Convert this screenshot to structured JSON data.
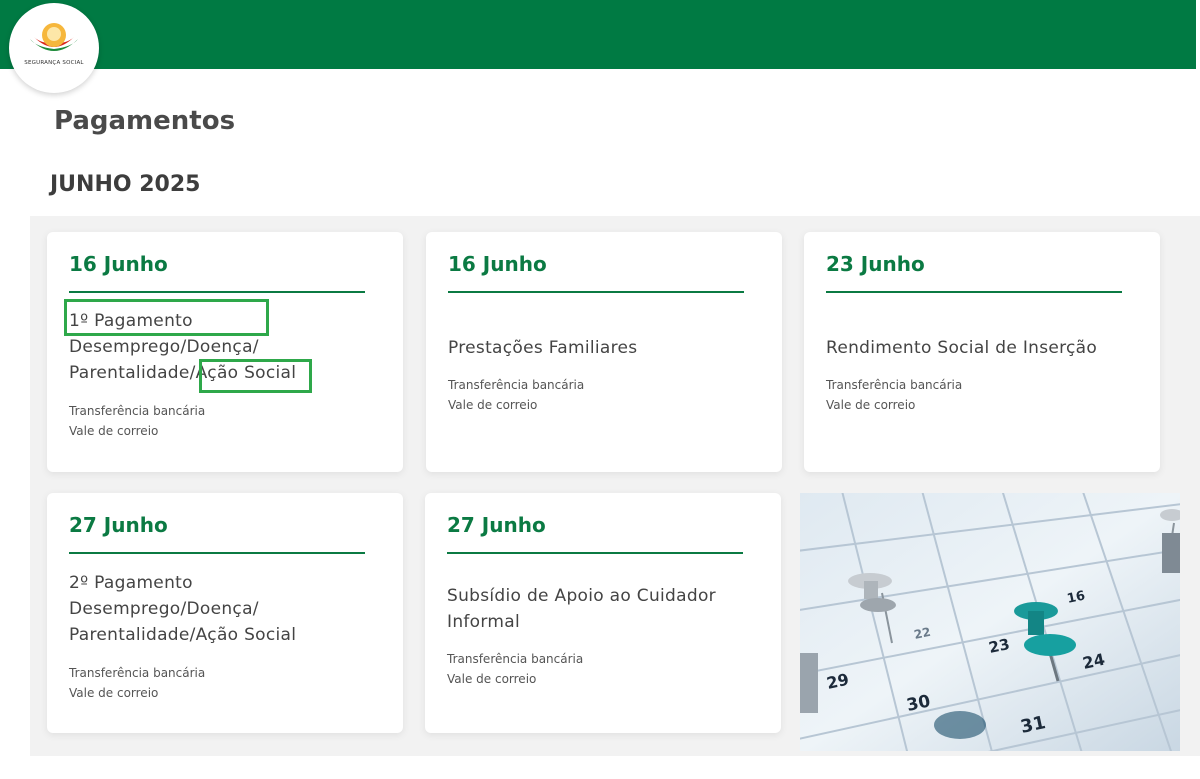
{
  "header": {
    "brand_color": "#007a43",
    "logo_text": "SEGURANÇA SOCIAL"
  },
  "page": {
    "title": "Pagamentos",
    "month": "JUNHO 2025"
  },
  "accent_color": "#0b7a43",
  "highlight_color": "#2ea84a",
  "cards": [
    {
      "date": "16 Junho",
      "title_lines": [
        "1º Pagamento",
        "Desemprego/Doença/",
        "Parentalidade/Ação Social"
      ],
      "methods": [
        "Transferência bancária",
        "Vale de correio"
      ],
      "highlights": [
        "1º Pagamento",
        "Ação Social"
      ]
    },
    {
      "date": "16 Junho",
      "title_lines": [
        "Prestações Familiares"
      ],
      "methods": [
        "Transferência bancária",
        "Vale de correio"
      ]
    },
    {
      "date": "23 Junho",
      "title_lines": [
        "Rendimento Social de Inserção"
      ],
      "methods": [
        "Transferência bancária",
        "Vale de correio"
      ]
    },
    {
      "date": "27 Junho",
      "title_lines": [
        "2º Pagamento",
        "Desemprego/Doença/",
        "Parentalidade/Ação Social"
      ],
      "methods": [
        "Transferência bancária",
        "Vale de correio"
      ]
    },
    {
      "date": "27 Junho",
      "title_lines": [
        "Subsídio de Apoio ao Cuidador",
        "Informal"
      ],
      "methods": [
        "Transferência bancária",
        "Vale de correio"
      ]
    }
  ],
  "calendar_image": {
    "numbers": [
      "16",
      "22",
      "23",
      "24",
      "29",
      "30",
      "31"
    ],
    "pin_color": "#1a9a9a"
  }
}
